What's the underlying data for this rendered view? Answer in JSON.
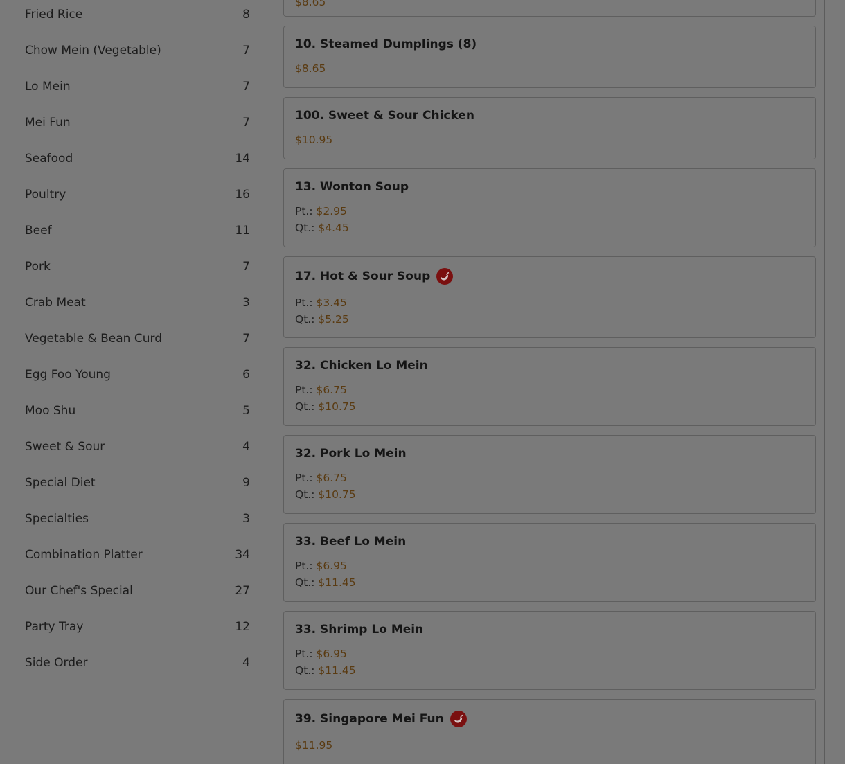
{
  "categories": [
    {
      "name": "Fried Rice",
      "count": "8"
    },
    {
      "name": "Chow Mein (Vegetable)",
      "count": "7"
    },
    {
      "name": "Lo Mein",
      "count": "7"
    },
    {
      "name": "Mei Fun",
      "count": "7"
    },
    {
      "name": "Seafood",
      "count": "14"
    },
    {
      "name": "Poultry",
      "count": "16"
    },
    {
      "name": "Beef",
      "count": "11"
    },
    {
      "name": "Pork",
      "count": "7"
    },
    {
      "name": "Crab Meat",
      "count": "3"
    },
    {
      "name": "Vegetable & Bean Curd",
      "count": "7"
    },
    {
      "name": "Egg Foo Young",
      "count": "6"
    },
    {
      "name": "Moo Shu",
      "count": "5"
    },
    {
      "name": "Sweet & Sour",
      "count": "4"
    },
    {
      "name": "Special Diet",
      "count": "9"
    },
    {
      "name": "Specialties",
      "count": "3"
    },
    {
      "name": "Combination Platter",
      "count": "34"
    },
    {
      "name": "Our Chef's Special",
      "count": "27"
    },
    {
      "name": "Party Tray",
      "count": "12"
    },
    {
      "name": "Side Order",
      "count": "4"
    }
  ],
  "items": [
    {
      "title": "",
      "spicy": false,
      "prices": [
        {
          "label": "",
          "value": "$8.65"
        }
      ]
    },
    {
      "title": "10. Steamed Dumplings (8)",
      "spicy": false,
      "prices": [
        {
          "label": "",
          "value": "$8.65"
        }
      ]
    },
    {
      "title": "100. Sweet & Sour Chicken",
      "spicy": false,
      "prices": [
        {
          "label": "",
          "value": "$10.95"
        }
      ]
    },
    {
      "title": "13. Wonton Soup",
      "spicy": false,
      "prices": [
        {
          "label": "Pt.: ",
          "value": "$2.95"
        },
        {
          "label": "Qt.: ",
          "value": "$4.45"
        }
      ]
    },
    {
      "title": "17. Hot & Sour Soup",
      "spicy": true,
      "prices": [
        {
          "label": "Pt.: ",
          "value": "$3.45"
        },
        {
          "label": "Qt.: ",
          "value": "$5.25"
        }
      ]
    },
    {
      "title": "32. Chicken Lo Mein",
      "spicy": false,
      "prices": [
        {
          "label": "Pt.: ",
          "value": "$6.75"
        },
        {
          "label": "Qt.: ",
          "value": "$10.75"
        }
      ]
    },
    {
      "title": "32. Pork Lo Mein",
      "spicy": false,
      "prices": [
        {
          "label": "Pt.: ",
          "value": "$6.75"
        },
        {
          "label": "Qt.: ",
          "value": "$10.75"
        }
      ]
    },
    {
      "title": "33. Beef Lo Mein",
      "spicy": false,
      "prices": [
        {
          "label": "Pt.: ",
          "value": "$6.95"
        },
        {
          "label": "Qt.: ",
          "value": "$11.45"
        }
      ]
    },
    {
      "title": "33. Shrimp Lo Mein",
      "spicy": false,
      "prices": [
        {
          "label": "Pt.: ",
          "value": "$6.95"
        },
        {
          "label": "Qt.: ",
          "value": "$11.45"
        }
      ]
    },
    {
      "title": "39. Singapore Mei Fun",
      "spicy": true,
      "prices": [
        {
          "label": "",
          "value": "$11.95"
        }
      ]
    }
  ],
  "icons": {
    "spicy": "chili-pepper-icon"
  },
  "colors": {
    "overlay": "#7a7a7a",
    "price": "#5a3b12",
    "spicy_badge": "#7a1010"
  }
}
